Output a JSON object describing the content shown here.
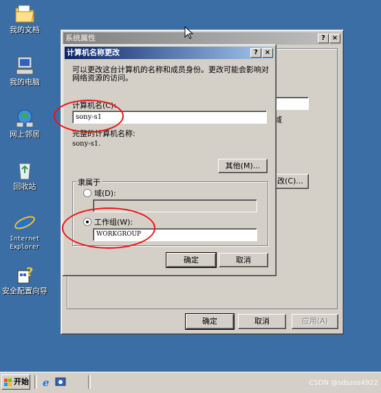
{
  "desktop": {
    "icons": [
      {
        "label": "我的文档",
        "icon": "my-documents-icon"
      },
      {
        "label": "我的电脑",
        "icon": "my-computer-icon"
      },
      {
        "label": "网上邻居",
        "icon": "network-places-icon"
      },
      {
        "label": "回收站",
        "icon": "recycle-bin-icon"
      },
      {
        "label": "Internet Explorer",
        "icon": "internet-explorer-icon"
      },
      {
        "label": "安全配置向导",
        "icon": "security-wizard-icon"
      }
    ]
  },
  "system_props": {
    "title": "系统属性",
    "help_btn": "?",
    "close_btn": "×",
    "partial_right_text": "域",
    "partial_btn": "改(C)...",
    "ok": "确定",
    "cancel": "取消",
    "apply": "应用(A)"
  },
  "dialog": {
    "title": "计算机名称更改",
    "help_btn": "?",
    "close_btn": "×",
    "description": "可以更改这台计算机的名称和成员身份。更改可能会影响对网络资源的访问。",
    "computer_name_label": "计算机名(C):",
    "computer_name_value": "sony-s1",
    "full_name_label": "完整的计算机名称:",
    "full_name_value": "sony-s1.",
    "more_button": "其他(M)...",
    "member_of": "隶属于",
    "domain_label": "域(D):",
    "domain_value": "",
    "workgroup_label": "工作组(W):",
    "workgroup_value": "WORKGROUP",
    "ok": "确定",
    "cancel": "取消"
  },
  "taskbar": {
    "start": "开始",
    "watermark": "CSDN @sdszos4922"
  },
  "colors": {
    "desktop": "#3a6ea5",
    "annotation": "#e11111"
  }
}
